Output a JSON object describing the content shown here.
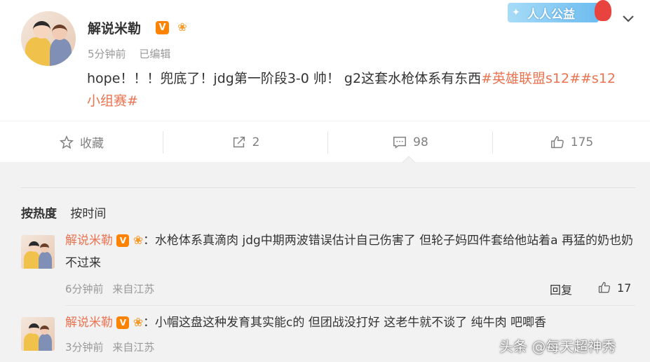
{
  "post": {
    "author": "解说米勒",
    "v_badge": "V",
    "time": "5分钟前",
    "edited": "已编辑",
    "content_text": "hope！！！兜底了！jdg第一阶段3-0 帅！ g2这套水枪体系有东西",
    "tags": [
      "#英雄联盟s12#",
      "#s12小组赛#"
    ],
    "promo_label": "人人公益"
  },
  "actions": {
    "favorite_label": "收藏",
    "share_count": "2",
    "comment_count": "98",
    "like_count": "175"
  },
  "sort": {
    "hot": "按热度",
    "time": "按时间"
  },
  "comments": [
    {
      "user": "解说米勒",
      "text": "：水枪体系真滴肉 jdg中期两波错误估计自己伤害了 但轮子妈四件套给他站着a 再猛的奶也奶不过来",
      "time": "6分钟前",
      "location": "来自江苏",
      "reply_label": "回复",
      "likes": "17"
    },
    {
      "user": "解说米勒",
      "text": "：小帽这盘这种发育其实能c的 但团战没打好 这老牛就不谈了 纯牛肉 吧唧香",
      "time": "3分钟前",
      "location": "来自江苏"
    }
  ],
  "watermark": "头条 @每天超神秀",
  "colors": {
    "accent": "#eb7350",
    "vip": "#ff8200",
    "muted": "#999999"
  },
  "icons": [
    "star-outline-icon",
    "share-icon",
    "comment-icon",
    "thumbs-up-icon",
    "chevron-down-icon",
    "flame-badge-icon"
  ]
}
